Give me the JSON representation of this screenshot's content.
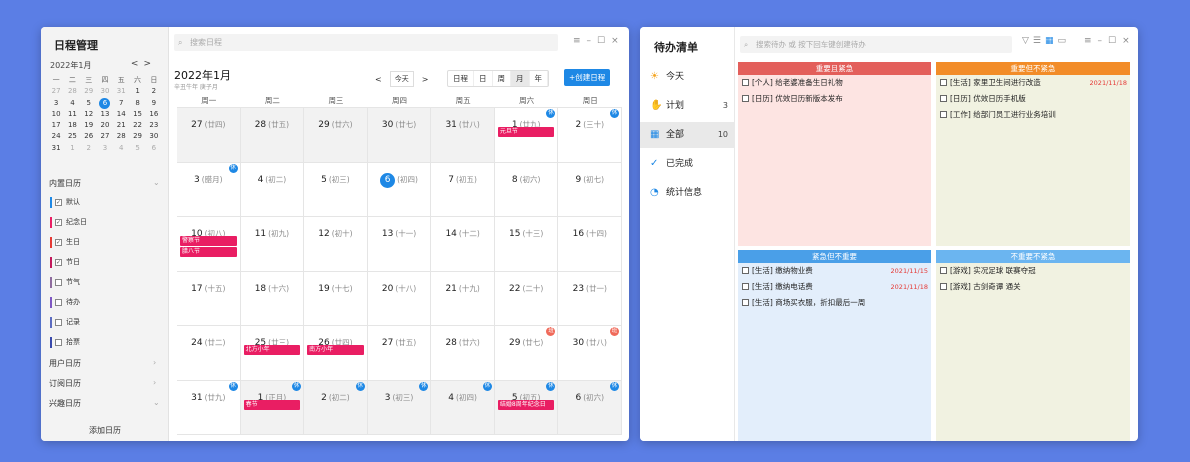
{
  "calendar_app": {
    "title": "日程管理",
    "mini": {
      "month": "2022年1月",
      "prev": "<",
      "next": ">",
      "weekdays": [
        "一",
        "二",
        "三",
        "四",
        "五",
        "六",
        "日"
      ],
      "rows": [
        [
          "27",
          "28",
          "29",
          "30",
          "31",
          "1",
          "2"
        ],
        [
          "3",
          "4",
          "5",
          "6",
          "7",
          "8",
          "9"
        ],
        [
          "10",
          "11",
          "12",
          "13",
          "14",
          "15",
          "16"
        ],
        [
          "17",
          "18",
          "19",
          "20",
          "21",
          "22",
          "23"
        ],
        [
          "24",
          "25",
          "26",
          "27",
          "28",
          "29",
          "30"
        ],
        [
          "31",
          "1",
          "2",
          "3",
          "4",
          "5",
          "6"
        ]
      ]
    },
    "builtin_label": "内置日历",
    "calendars": [
      {
        "label": "默认",
        "color": "#1e88e5",
        "checked": "☑"
      },
      {
        "label": "纪念日",
        "color": "#e91e63",
        "checked": "☑"
      },
      {
        "label": "生日",
        "color": "#e53935",
        "checked": "☑"
      },
      {
        "label": "节日",
        "color": "#c2185b",
        "checked": "☑"
      },
      {
        "label": "节气",
        "color": "#8e6b9e",
        "checked": "☐"
      },
      {
        "label": "待办",
        "color": "#7e57c2",
        "checked": "☐"
      },
      {
        "label": "记录",
        "color": "#5c6bc0",
        "checked": "☐"
      },
      {
        "label": "拾票",
        "color": "#3949ab",
        "checked": "☐"
      }
    ],
    "user_cal": "用户日历",
    "sub_cal": "订阅日历",
    "interest_cal": "兴趣日历",
    "add_cal": "添加日历",
    "search_placeholder": "搜索日程",
    "header": {
      "month_title": "2022年1月",
      "lunar": "辛丑牛年 庚子月",
      "prev": "<",
      "today": "今天",
      "next": ">",
      "views": [
        "日程",
        "日",
        "周",
        "月",
        "年"
      ],
      "active_view": "月",
      "create": "+创建日程"
    },
    "day_headers": [
      "周一",
      "周二",
      "周三",
      "周四",
      "周五",
      "周六",
      "周日"
    ],
    "weeks": [
      [
        {
          "d": "27",
          "l": "(廿四)",
          "gray": true
        },
        {
          "d": "28",
          "l": "(廿五)",
          "gray": true
        },
        {
          "d": "29",
          "l": "(廿六)",
          "gray": true
        },
        {
          "d": "30",
          "l": "(廿七)",
          "gray": true
        },
        {
          "d": "31",
          "l": "(廿八)",
          "gray": true
        },
        {
          "d": "1",
          "l": "(廿九)",
          "badge": "休",
          "badge_type": "rest",
          "events": [
            "元旦节"
          ]
        },
        {
          "d": "2",
          "l": "(三十)",
          "badge": "休",
          "badge_type": "rest"
        }
      ],
      [
        {
          "d": "3",
          "l": "(腊月)",
          "badge": "休",
          "badge_type": "rest"
        },
        {
          "d": "4",
          "l": "(初二)"
        },
        {
          "d": "5",
          "l": "(初三)"
        },
        {
          "d": "6",
          "l": "(初四)",
          "today": true
        },
        {
          "d": "7",
          "l": "(初五)"
        },
        {
          "d": "8",
          "l": "(初六)"
        },
        {
          "d": "9",
          "l": "(初七)"
        }
      ],
      [
        {
          "d": "10",
          "l": "(初八)",
          "events": [
            "警察节",
            "腊八节"
          ]
        },
        {
          "d": "11",
          "l": "(初九)"
        },
        {
          "d": "12",
          "l": "(初十)"
        },
        {
          "d": "13",
          "l": "(十一)"
        },
        {
          "d": "14",
          "l": "(十二)"
        },
        {
          "d": "15",
          "l": "(十三)"
        },
        {
          "d": "16",
          "l": "(十四)"
        }
      ],
      [
        {
          "d": "17",
          "l": "(十五)"
        },
        {
          "d": "18",
          "l": "(十六)"
        },
        {
          "d": "19",
          "l": "(十七)"
        },
        {
          "d": "20",
          "l": "(十八)"
        },
        {
          "d": "21",
          "l": "(十九)"
        },
        {
          "d": "22",
          "l": "(二十)"
        },
        {
          "d": "23",
          "l": "(廿一)"
        }
      ],
      [
        {
          "d": "24",
          "l": "(廿二)"
        },
        {
          "d": "25",
          "l": "(廿三)",
          "events": [
            "北方小年"
          ]
        },
        {
          "d": "26",
          "l": "(廿四)",
          "events": [
            "南方小年"
          ]
        },
        {
          "d": "27",
          "l": "(廿五)"
        },
        {
          "d": "28",
          "l": "(廿六)"
        },
        {
          "d": "29",
          "l": "(廿七)",
          "badge": "班",
          "badge_type": "work"
        },
        {
          "d": "30",
          "l": "(廿八)",
          "badge": "班",
          "badge_type": "work"
        }
      ],
      [
        {
          "d": "31",
          "l": "(廿九)",
          "badge": "休",
          "badge_type": "rest"
        },
        {
          "d": "1",
          "l": "(正月)",
          "badge": "休",
          "badge_type": "rest",
          "events": [
            "春节"
          ],
          "gray": true
        },
        {
          "d": "2",
          "l": "(初二)",
          "badge": "休",
          "badge_type": "rest",
          "gray": true
        },
        {
          "d": "3",
          "l": "(初三)",
          "badge": "休",
          "badge_type": "rest",
          "gray": true
        },
        {
          "d": "4",
          "l": "(初四)",
          "badge": "休",
          "badge_type": "rest",
          "gray": true
        },
        {
          "d": "5",
          "l": "(初五)",
          "badge": "休",
          "badge_type": "rest",
          "events": [
            "结婚8周年纪念日"
          ],
          "gray": true
        },
        {
          "d": "6",
          "l": "(初六)",
          "badge": "休",
          "badge_type": "rest",
          "gray": true
        }
      ]
    ]
  },
  "todo_app": {
    "title": "待办清单",
    "search_placeholder": "搜索待办 或 按下回车键创建待办",
    "nav": [
      {
        "label": "今天",
        "icon": "☀",
        "count": "",
        "color": "#f5a623"
      },
      {
        "label": "计划",
        "icon": "✋",
        "count": "3",
        "color": "#f5a623"
      },
      {
        "label": "全部",
        "icon": "▦",
        "count": "10",
        "color": "#1e88e5",
        "active": true
      },
      {
        "label": "已完成",
        "icon": "✓",
        "count": "",
        "color": "#1e88e5"
      },
      {
        "label": "统计信息",
        "icon": "◔",
        "count": "",
        "color": "#1e88e5"
      }
    ],
    "quadrants": [
      {
        "title": "重要且紧急",
        "head": "#e35f5b",
        "bg": "#fde4e2",
        "items": [
          {
            "text": "[个人] 给老婆准备生日礼物",
            "date": ""
          },
          {
            "text": "[日历] 优效日历新版本发布",
            "date": ""
          }
        ]
      },
      {
        "title": "重要但不紧急",
        "head": "#f28c28",
        "bg": "#f1f2e1",
        "items": [
          {
            "text": "[生活] 家里卫生间进行改造",
            "date": "2021/11/18"
          },
          {
            "text": "[日历] 优效日历手机版",
            "date": ""
          },
          {
            "text": "[工作] 给部门员工进行业务培训",
            "date": ""
          }
        ]
      },
      {
        "title": "紧急但不重要",
        "head": "#4a9fe8",
        "bg": "#e3eefb",
        "items": [
          {
            "text": "[生活] 缴纳物业费",
            "date": "2021/11/15"
          },
          {
            "text": "[生活] 缴纳电话费",
            "date": "2021/11/18"
          },
          {
            "text": "[生活] 商场买衣服，折扣最后一周",
            "date": ""
          }
        ]
      },
      {
        "title": "不重要不紧急",
        "head": "#6bb5f0",
        "bg": "#f1f2e1",
        "items": [
          {
            "text": "[游戏] 实况足球 联赛夺冠",
            "date": ""
          },
          {
            "text": "[游戏] 古剑奇谭 通关",
            "date": ""
          }
        ]
      }
    ]
  }
}
